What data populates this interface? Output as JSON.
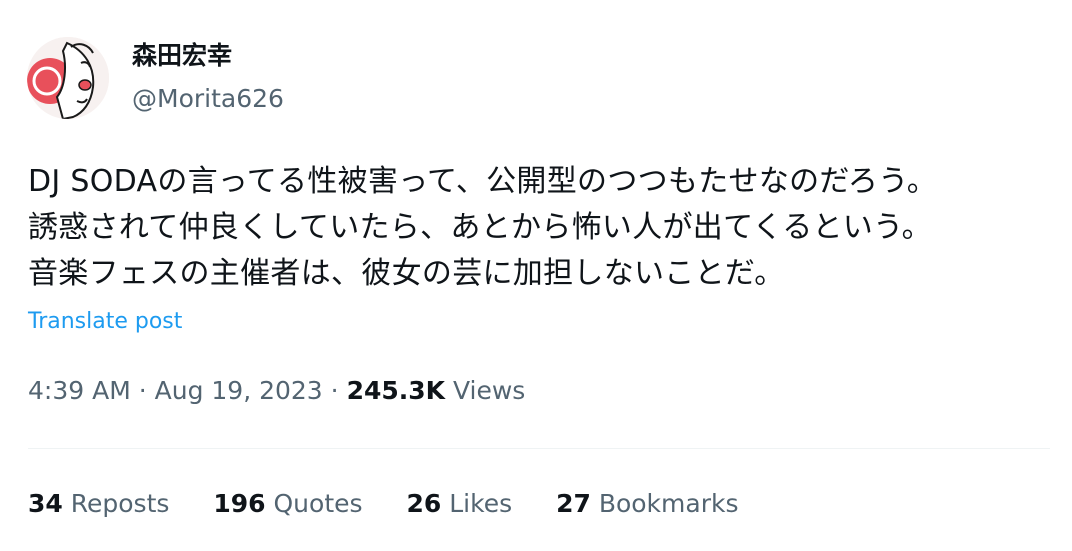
{
  "author": {
    "display_name": "森田宏幸",
    "handle": "@Morita626",
    "avatar_icon": "avatar-illustration-icon"
  },
  "post": {
    "lines": [
      "DJ SODAの言ってる性被害って、公開型のつつもたせなのだろう。",
      "誘惑されて仲良くしていたら、あとから怖い人が出てくるという。",
      "音楽フェスの主催者は、彼女の芸に加担しないことだ。"
    ],
    "translate_label": "Translate post"
  },
  "meta": {
    "time": "4:39 AM",
    "separator": "·",
    "date": "Aug 19, 2023",
    "views_count": "245.3K",
    "views_label": "Views"
  },
  "stats": [
    {
      "count": "34",
      "label": "Reposts"
    },
    {
      "count": "196",
      "label": "Quotes"
    },
    {
      "count": "26",
      "label": "Likes"
    },
    {
      "count": "27",
      "label": "Bookmarks"
    }
  ],
  "colors": {
    "text": "#0f1419",
    "secondary": "#536471",
    "link": "#1d9bf0",
    "divider": "#eff3f4",
    "avatar_accent": "#e8505b"
  }
}
